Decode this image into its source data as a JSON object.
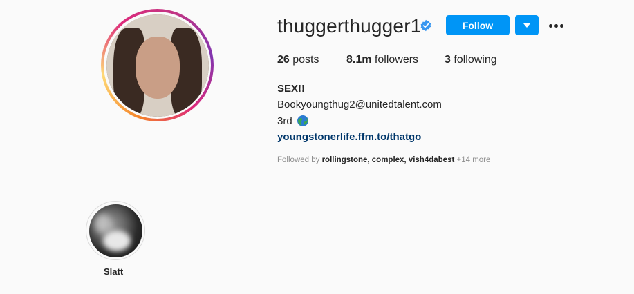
{
  "profile": {
    "username": "thuggerthugger1",
    "follow_label": "Follow"
  },
  "stats": {
    "posts_count": "26",
    "posts_label": "posts",
    "followers_count": "8.1m",
    "followers_label": "followers",
    "following_count": "3",
    "following_label": "following"
  },
  "bio": {
    "name": "SEX!!",
    "email": "Bookyoungthug2@unitedtalent.com",
    "line3": "3rd",
    "link": "youngstonerlife.ffm.to/thatgo"
  },
  "followed_by": {
    "prefix": "Followed by",
    "names": "rollingstone, complex, vish4dabest",
    "more": "+14 more"
  },
  "highlights": [
    {
      "label": "Slatt"
    }
  ],
  "colors": {
    "accent": "#0095f6",
    "link": "#00376b",
    "secondary_text": "#8e8e8e"
  }
}
